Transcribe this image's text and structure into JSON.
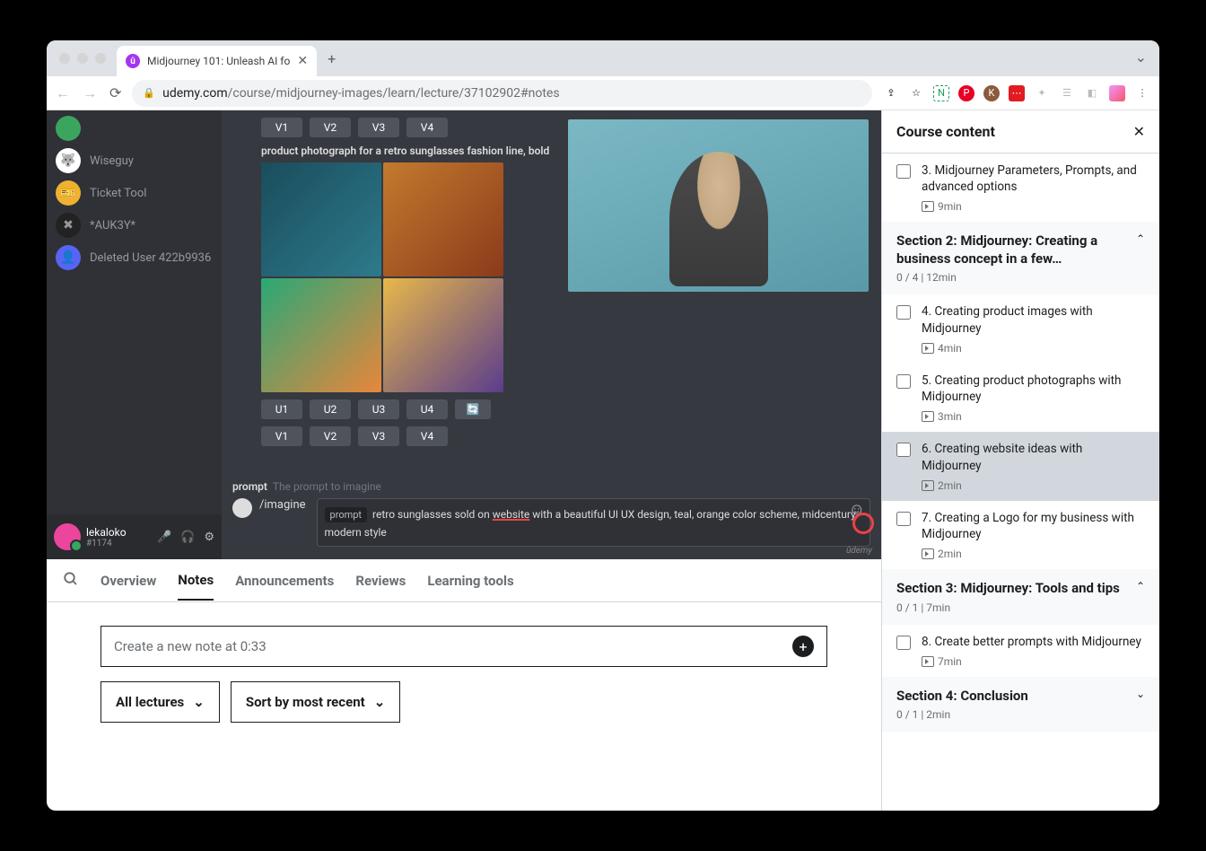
{
  "browser": {
    "tab_title": "Midjourney 101: Unleash AI fo",
    "new_tab": "+",
    "url_domain": "udemy.com",
    "url_path": "/course/midjourney-images/learn/lecture/37102902#notes"
  },
  "discord": {
    "members": [
      {
        "name": "",
        "avatar_bg": "#3ba55d"
      },
      {
        "name": "Wiseguy",
        "avatar_bg": "#fff"
      },
      {
        "name": "Ticket Tool",
        "avatar_bg": "#f0b132"
      },
      {
        "name": "*AUK3Y*",
        "avatar_bg": "#222"
      },
      {
        "name": "Deleted User 422b9936",
        "avatar_bg": "#5865f2"
      }
    ],
    "caption": "product photograph for a retro sunglasses fashion line, bold",
    "rows_top": [
      "V1",
      "V2",
      "V3",
      "V4"
    ],
    "rows_u": [
      "U1",
      "U2",
      "U3",
      "U4"
    ],
    "rows_v": [
      "V1",
      "V2",
      "V3",
      "V4"
    ],
    "prompt_label": "prompt",
    "prompt_hint": "The prompt to imagine",
    "imagine": "/imagine",
    "prompt_tag": "prompt",
    "prompt_text_1": "retro sunglasses sold on ",
    "prompt_text_underline": "website",
    "prompt_text_2": " with a beautiful UI UX design, teal, orange color scheme, midcentury modern style",
    "user": "lekaloko",
    "discriminator": "#1174",
    "watermark": "ûdemy"
  },
  "tabs": {
    "overview": "Overview",
    "notes": "Notes",
    "announcements": "Announcements",
    "reviews": "Reviews",
    "learning": "Learning tools"
  },
  "notes": {
    "placeholder": "Create a new note at 0:33",
    "filter_lectures": "All lectures",
    "filter_sort": "Sort by most recent"
  },
  "course_content": {
    "title": "Course content",
    "items": [
      {
        "type": "lesson",
        "title": "3. Midjourney Parameters, Prompts, and advanced options",
        "duration": "9min"
      },
      {
        "type": "section",
        "title": "Section 2: Midjourney: Creating a business concept in a few…",
        "meta": "0 / 4 | 12min",
        "open": true
      },
      {
        "type": "lesson",
        "title": "4. Creating product images with Midjourney",
        "duration": "4min"
      },
      {
        "type": "lesson",
        "title": "5. Creating product photographs with Midjourney",
        "duration": "3min"
      },
      {
        "type": "lesson",
        "title": "6. Creating website ideas with Midjourney",
        "duration": "2min",
        "active": true
      },
      {
        "type": "lesson",
        "title": "7. Creating a Logo for my business with Midjourney",
        "duration": "2min"
      },
      {
        "type": "section",
        "title": "Section 3: Midjourney: Tools and tips",
        "meta": "0 / 1 | 7min",
        "open": true
      },
      {
        "type": "lesson",
        "title": "8. Create better prompts with Midjourney",
        "duration": "7min"
      },
      {
        "type": "section",
        "title": "Section 4: Conclusion",
        "meta": "0 / 1 | 2min",
        "open": false
      }
    ]
  }
}
